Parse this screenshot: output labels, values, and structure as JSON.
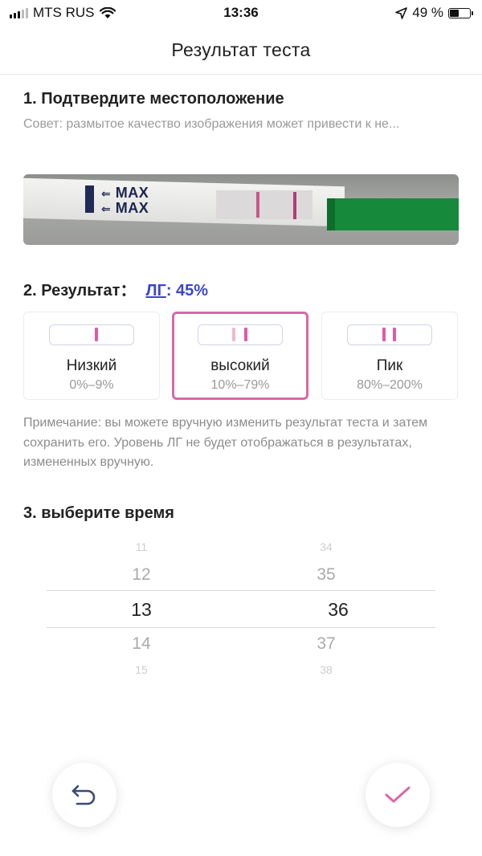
{
  "status_bar": {
    "carrier": "MTS RUS",
    "time": "13:36",
    "battery": "49 %",
    "battery_level": 0.49
  },
  "header": {
    "title": "Результат теста"
  },
  "section1": {
    "title": "1. Подтвердите местоположение",
    "tip": "Совет: размытое качество изображения может привести к не...",
    "strip_text": "MAX"
  },
  "section2": {
    "title": "2. Результат：",
    "lh_label": "ЛГ",
    "lh_value": ": 45%",
    "cards": [
      {
        "label": "Низкий",
        "range": "0%–9%",
        "selected": false
      },
      {
        "label": "высокий",
        "range": "10%–79%",
        "selected": true
      },
      {
        "label": "Пик",
        "range": "80%–200%",
        "selected": false
      }
    ],
    "note": "Примечание: вы можете вручную изменить результат теста и затем сохранить его. Уровень ЛГ не будет отображаться в результатах, измененных вручную."
  },
  "section3": {
    "title": "3. выберите время",
    "hours": [
      "11",
      "12",
      "13",
      "14",
      "15"
    ],
    "minutes": [
      "34",
      "35",
      "36",
      "37",
      "38"
    ]
  },
  "colors": {
    "accent_pink": "#d868a6",
    "link_blue": "#3d46c9",
    "icon_navy": "#3b4a73"
  }
}
